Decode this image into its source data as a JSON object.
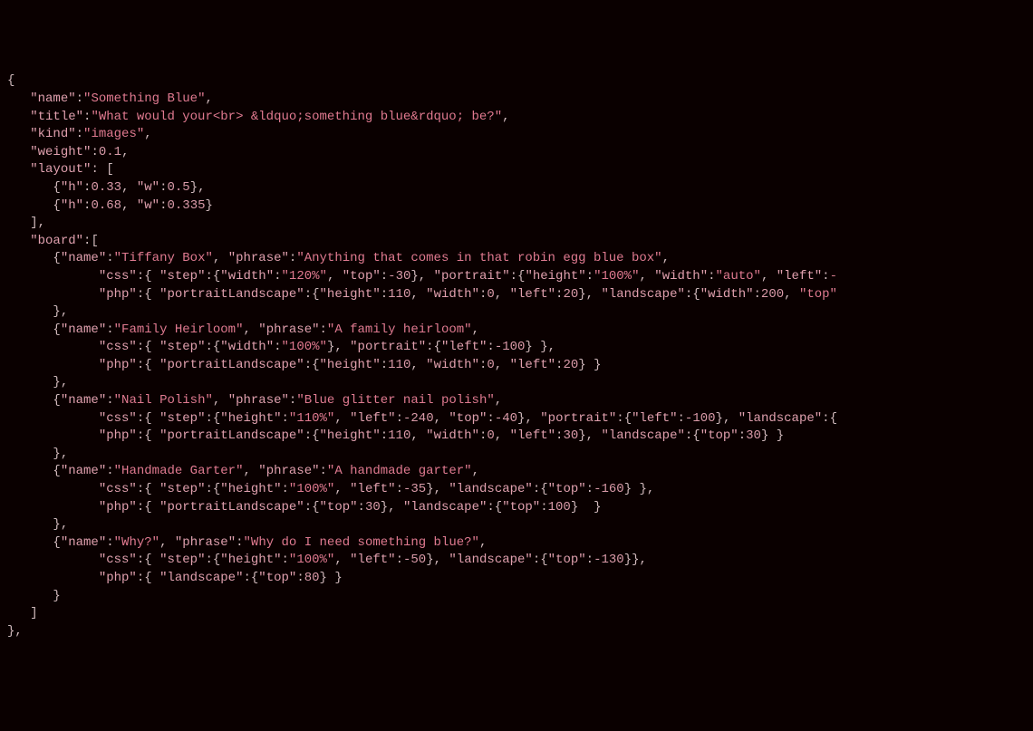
{
  "code": {
    "lines": [
      {
        "indent": 0,
        "text": "{"
      },
      {
        "indent": 1,
        "kv": [
          {
            "k": "name",
            "v": "Something Blue",
            "t": "s"
          }
        ],
        "trail": ","
      },
      {
        "indent": 1,
        "kv": [
          {
            "k": "title",
            "v": "What would your<br> &ldquo;something blue&rdquo; be?",
            "t": "s"
          }
        ],
        "trail": ","
      },
      {
        "indent": 1,
        "kv": [
          {
            "k": "kind",
            "v": "images",
            "t": "s"
          }
        ],
        "trail": ","
      },
      {
        "indent": 1,
        "kv": [
          {
            "k": "weight",
            "v": "0.1",
            "t": "n"
          }
        ],
        "trail": ","
      },
      {
        "indent": 1,
        "raw": "\"layout\": ["
      },
      {
        "indent": 2,
        "raw": "{\"h\":0.33, \"w\":0.5},"
      },
      {
        "indent": 2,
        "raw": "{\"h\":0.68, \"w\":0.335}"
      },
      {
        "indent": 1,
        "raw": "],"
      },
      {
        "indent": 1,
        "raw": "\"board\":["
      },
      {
        "indent": 2,
        "raw": "{\"name\":\"Tiffany Box\", \"phrase\":\"Anything that comes in that robin egg blue box\","
      },
      {
        "indent": 4,
        "raw": "\"css\":{ \"step\":{\"width\":\"120%\", \"top\":-30}, \"portrait\":{\"height\":\"100%\", \"width\":\"auto\", \"left\":-"
      },
      {
        "indent": 4,
        "raw": "\"php\":{ \"portraitLandscape\":{\"height\":110, \"width\":0, \"left\":20}, \"landscape\":{\"width\":200, \"top\""
      },
      {
        "indent": 2,
        "raw": "},"
      },
      {
        "indent": 2,
        "raw": "{\"name\":\"Family Heirloom\", \"phrase\":\"A family heirloom\","
      },
      {
        "indent": 4,
        "raw": "\"css\":{ \"step\":{\"width\":\"100%\"}, \"portrait\":{\"left\":-100} },"
      },
      {
        "indent": 4,
        "raw": "\"php\":{ \"portraitLandscape\":{\"height\":110, \"width\":0, \"left\":20} }"
      },
      {
        "indent": 2,
        "raw": "},"
      },
      {
        "indent": 2,
        "raw": "{\"name\":\"Nail Polish\", \"phrase\":\"Blue glitter nail polish\","
      },
      {
        "indent": 4,
        "raw": "\"css\":{ \"step\":{\"height\":\"110%\", \"left\":-240, \"top\":-40}, \"portrait\":{\"left\":-100}, \"landscape\":{"
      },
      {
        "indent": 4,
        "raw": "\"php\":{ \"portraitLandscape\":{\"height\":110, \"width\":0, \"left\":30}, \"landscape\":{\"top\":30} }"
      },
      {
        "indent": 2,
        "raw": "},"
      },
      {
        "indent": 2,
        "raw": "{\"name\":\"Handmade Garter\", \"phrase\":\"A handmade garter\","
      },
      {
        "indent": 4,
        "raw": "\"css\":{ \"step\":{\"height\":\"100%\", \"left\":-35}, \"landscape\":{\"top\":-160} },"
      },
      {
        "indent": 4,
        "raw": "\"php\":{ \"portraitLandscape\":{\"top\":30}, \"landscape\":{\"top\":100}  }"
      },
      {
        "indent": 2,
        "raw": "},"
      },
      {
        "indent": 2,
        "raw": "{\"name\":\"Why?\", \"phrase\":\"Why do I need something blue?\","
      },
      {
        "indent": 4,
        "raw": "\"css\":{ \"step\":{\"height\":\"100%\", \"left\":-50}, \"landscape\":{\"top\":-130}},"
      },
      {
        "indent": 4,
        "raw": "\"php\":{ \"landscape\":{\"top\":80} }"
      },
      {
        "indent": 2,
        "raw": "}"
      },
      {
        "indent": 1,
        "raw": "]"
      },
      {
        "indent": 0,
        "raw": "},"
      }
    ]
  }
}
